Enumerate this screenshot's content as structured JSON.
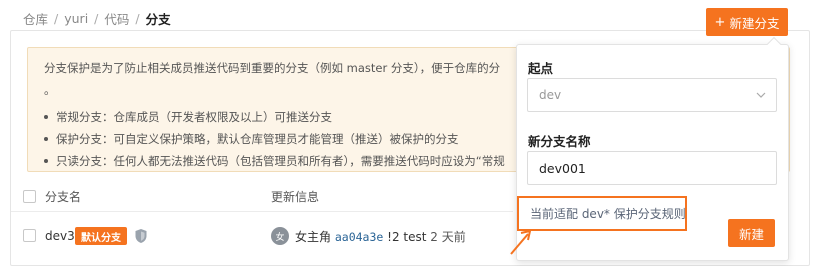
{
  "breadcrumb": {
    "items": [
      "仓库",
      "yuri",
      "代码"
    ],
    "separator": "/",
    "current": "分支"
  },
  "toolbar": {
    "new_branch_label": "新建分支",
    "new_branch_icon": "+"
  },
  "info": {
    "intro": "分支保护是为了防止相关成员推送代码到重要的分支（例如 master 分支），便于仓库的分",
    "intro_continued": "。",
    "items": [
      "常规分支：仓库成员（开发者权限及以上）可推送分支",
      "保护分支：可自定义保护策略，默认仓库管理员才能管理（推送）被保护的分支",
      "只读分支：任何人都无法推送代码（包括管理员和所有者），需要推送代码时应设为“常规"
    ]
  },
  "table": {
    "columns": [
      "分支名",
      "更新信息"
    ],
    "rows": [
      {
        "branch": "dev3",
        "badge": "默认分支",
        "avatar_text": "女",
        "author": "女主角",
        "hash": "aa04a3e",
        "message": "!2 test",
        "time": "2 天前"
      }
    ]
  },
  "popup": {
    "origin_label": "起点",
    "origin_value": "dev",
    "name_label": "新分支名称",
    "name_value": "dev001",
    "hint": "当前适配 dev* 保护分支规则",
    "create_label": "新建"
  },
  "colors": {
    "accent": "#f5731f",
    "info_bg": "#fdf5e8"
  }
}
